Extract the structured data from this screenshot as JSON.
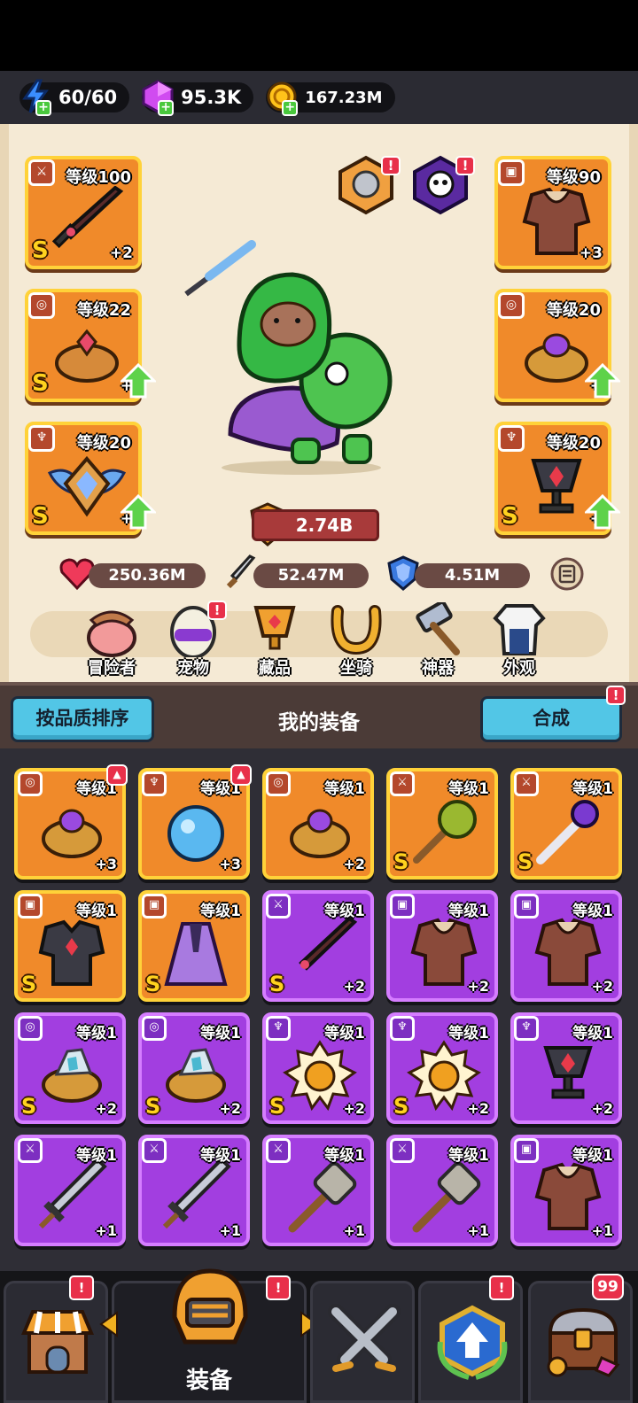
{
  "resources": [
    {
      "name": "energy",
      "value": "60/60",
      "icon": "lightning-icon"
    },
    {
      "name": "gems",
      "value": "95.3K",
      "icon": "gem-icon"
    },
    {
      "name": "gold",
      "value": "167.23M",
      "icon": "coin-icon"
    }
  ],
  "equipped": {
    "weapon": {
      "level": "等级100",
      "plus": "+2",
      "rank": "S"
    },
    "ring_left": {
      "level": "等级22",
      "plus": "+",
      "rank": "S"
    },
    "necklace_left": {
      "level": "等级20",
      "plus": "+",
      "rank": "S"
    },
    "armor": {
      "level": "等级90",
      "plus": "+3"
    },
    "ring_right": {
      "level": "等级20",
      "plus": "+"
    },
    "necklace_right": {
      "level": "等级20",
      "plus": "+",
      "rank": "S"
    }
  },
  "badges": {
    "exclaim": "!",
    "count": "99"
  },
  "power": "2.74B",
  "stats": {
    "hp": "250.36M",
    "attack": "52.47M",
    "defense": "4.51M"
  },
  "menu": [
    {
      "label": "冒险者",
      "icon": "adventurer-icon"
    },
    {
      "label": "宠物",
      "icon": "pet-icon"
    },
    {
      "label": "藏品",
      "icon": "collection-icon"
    },
    {
      "label": "坐骑",
      "icon": "mount-icon"
    },
    {
      "label": "神器",
      "icon": "artifact-icon"
    },
    {
      "label": "外观",
      "icon": "outfit-icon"
    }
  ],
  "panel": {
    "sort_label": "按品质排序",
    "title": "我的装备",
    "merge_label": "合成"
  },
  "items": [
    {
      "level": "等级1",
      "plus": "+3",
      "rank": "",
      "color": "orange",
      "type": "ring",
      "new": true
    },
    {
      "level": "等级1",
      "plus": "+3",
      "rank": "",
      "color": "orange",
      "type": "orb",
      "new": true
    },
    {
      "level": "等级1",
      "plus": "+2",
      "rank": "",
      "color": "orange",
      "type": "ring",
      "new": false
    },
    {
      "level": "等级1",
      "plus": "",
      "rank": "S",
      "color": "orange",
      "type": "mace",
      "new": false
    },
    {
      "level": "等级1",
      "plus": "",
      "rank": "S",
      "color": "orange",
      "type": "staff",
      "new": false
    },
    {
      "level": "等级1",
      "plus": "",
      "rank": "S",
      "color": "orange",
      "type": "armor-dark",
      "new": false
    },
    {
      "level": "等级1",
      "plus": "",
      "rank": "S",
      "color": "orange",
      "type": "cloak",
      "new": false
    },
    {
      "level": "等级1",
      "plus": "+2",
      "rank": "S",
      "color": "purple",
      "type": "sword-dark",
      "new": false
    },
    {
      "level": "等级1",
      "plus": "+2",
      "rank": "",
      "color": "purple",
      "type": "fur",
      "new": false
    },
    {
      "level": "等级1",
      "plus": "+2",
      "rank": "",
      "color": "purple",
      "type": "fur",
      "new": false
    },
    {
      "level": "等级1",
      "plus": "+2",
      "rank": "S",
      "color": "purple",
      "type": "crystal-ring",
      "new": false
    },
    {
      "level": "等级1",
      "plus": "+2",
      "rank": "S",
      "color": "purple",
      "type": "crystal-ring",
      "new": false
    },
    {
      "level": "等级1",
      "plus": "+2",
      "rank": "S",
      "color": "purple",
      "type": "sun-medal",
      "new": false
    },
    {
      "level": "等级1",
      "plus": "+2",
      "rank": "S",
      "color": "purple",
      "type": "sun-medal",
      "new": false
    },
    {
      "level": "等级1",
      "plus": "+2",
      "rank": "",
      "color": "purple",
      "type": "chalice",
      "new": false
    },
    {
      "level": "等级1",
      "plus": "+1",
      "rank": "",
      "color": "purple",
      "type": "sword",
      "new": false
    },
    {
      "level": "等级1",
      "plus": "+1",
      "rank": "",
      "color": "purple",
      "type": "sword",
      "new": false
    },
    {
      "level": "等级1",
      "plus": "+1",
      "rank": "",
      "color": "purple",
      "type": "hammer",
      "new": false
    },
    {
      "level": "等级1",
      "plus": "+1",
      "rank": "",
      "color": "purple",
      "type": "hammer",
      "new": false
    },
    {
      "level": "等级1",
      "plus": "+1",
      "rank": "",
      "color": "purple",
      "type": "fur",
      "new": false
    }
  ],
  "nav": [
    {
      "name": "shop",
      "label": ""
    },
    {
      "name": "equipment",
      "label": "装备"
    },
    {
      "name": "battle",
      "label": ""
    },
    {
      "name": "upgrade",
      "label": ""
    },
    {
      "name": "chest",
      "label": ""
    }
  ]
}
